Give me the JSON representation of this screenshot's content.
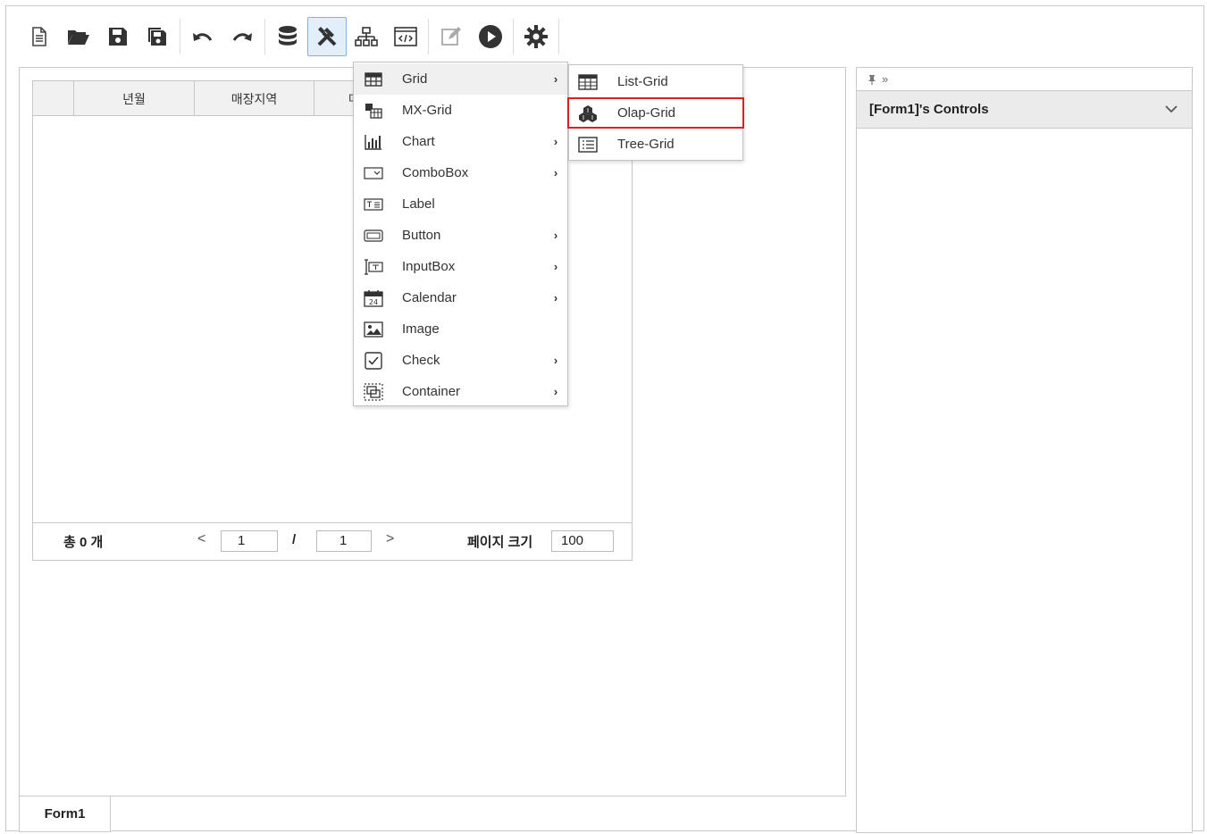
{
  "toolbar": {
    "buttons": [
      "new-file",
      "open-folder",
      "save",
      "save-as",
      "undo",
      "redo",
      "database",
      "tools",
      "hierarchy",
      "code-view",
      "edit",
      "run",
      "settings"
    ],
    "active": "tools"
  },
  "grid": {
    "columns": [
      "",
      "년월",
      "매장지역",
      "매"
    ],
    "footer": {
      "total_label": "총  0 개",
      "current_page": "1",
      "slash": "/",
      "total_pages": "1",
      "page_size_label": "페이지 크기",
      "page_size": "100",
      "prev_glyph": "<",
      "next_glyph": ">"
    }
  },
  "form_tab": {
    "label": "Form1"
  },
  "panel": {
    "pin_glyph": "📌 »",
    "title": "[Form1]'s Controls"
  },
  "menu": {
    "items": [
      {
        "label": "Grid",
        "icon": "grid-icon",
        "submenu": true,
        "highlighted": true
      },
      {
        "label": "MX-Grid",
        "icon": "mx-grid-icon",
        "submenu": false
      },
      {
        "label": "Chart",
        "icon": "chart-icon",
        "submenu": true
      },
      {
        "label": "ComboBox",
        "icon": "combobox-icon",
        "submenu": true
      },
      {
        "label": "Label",
        "icon": "label-icon",
        "submenu": false
      },
      {
        "label": "Button",
        "icon": "button-icon",
        "submenu": true
      },
      {
        "label": "InputBox",
        "icon": "inputbox-icon",
        "submenu": true
      },
      {
        "label": "Calendar",
        "icon": "calendar-icon",
        "submenu": true
      },
      {
        "label": "Image",
        "icon": "image-icon",
        "submenu": false
      },
      {
        "label": "Check",
        "icon": "check-icon",
        "submenu": true
      },
      {
        "label": "Container",
        "icon": "container-icon",
        "submenu": true
      }
    ],
    "arrow_glyph": "›"
  },
  "submenu": {
    "items": [
      {
        "label": "List-Grid",
        "icon": "list-grid-icon"
      },
      {
        "label": "Olap-Grid",
        "icon": "olap-grid-icon",
        "selected": true
      },
      {
        "label": "Tree-Grid",
        "icon": "tree-grid-icon"
      }
    ]
  },
  "colors": {
    "selection_border": "#d81f2a",
    "active_button_bg": "#e3eefb",
    "active_button_border": "#7fb0e6"
  }
}
